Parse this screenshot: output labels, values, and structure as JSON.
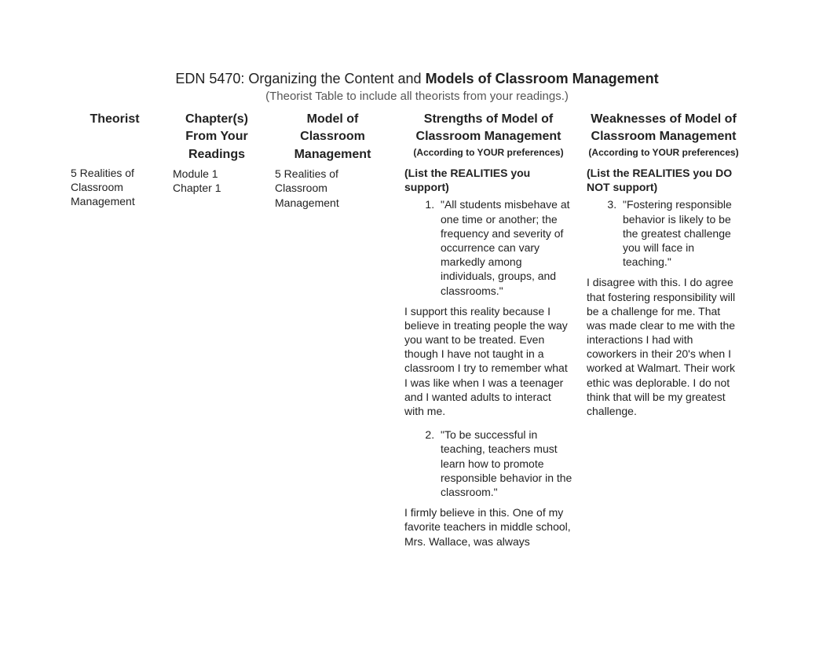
{
  "title_prefix": "EDN 5470:  Organizing the Content and ",
  "title_bold": "Models of Classroom Management",
  "subtitle": "(Theorist Table to include all theorists from your readings.)",
  "headers": {
    "theorist": "Theorist",
    "chapters": "Chapter(s) From Your Readings",
    "model": "Model of Classroom Management",
    "strengths": "Strengths of Model of Classroom Management",
    "strengths_sub": "(According to YOUR preferences)",
    "weaknesses": "Weaknesses of Model of Classroom Management",
    "weaknesses_sub": "(According to YOUR preferences)"
  },
  "row": {
    "theorist": "5 Realities of Classroom Management",
    "chapters_l1": "Module 1",
    "chapters_l2": "Chapter 1",
    "model": "5 Realities of Classroom Management",
    "strengths_heading": "(List the REALITIES you support)",
    "strength_item1": "\"All students misbehave at one time or another; the frequency and severity of occurrence can vary markedly among individuals, groups, and classrooms.\"",
    "strength_p1": "I support this reality because I believe in treating people the way you want to be treated. Even though I have not taught in a classroom I try to remember what I was like when I was a teenager and I wanted adults to interact with me.",
    "strength_item2": "\"To be successful in teaching, teachers must learn how to promote responsible behavior in the classroom.\"",
    "strength_p2": "I firmly believe in this. One of my favorite teachers in middle school, Mrs. Wallace, was always",
    "weaknesses_heading": "(List the REALITIES you DO NOT support)",
    "weakness_item3": "\"Fostering responsible behavior is likely to be the greatest challenge you will face in teaching.\"",
    "weakness_p1": "I disagree with this. I do agree that fostering responsibility will be a challenge for me. That was made clear to me with the interactions I had with coworkers in their 20's when I worked at Walmart. Their work ethic was deplorable. I do not think that will be my greatest challenge."
  }
}
